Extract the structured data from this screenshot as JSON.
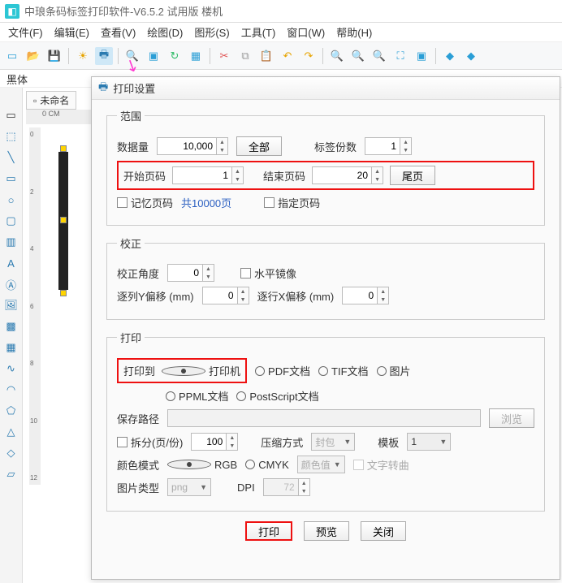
{
  "titlebar": {
    "title": "中琅条码标签打印软件-V6.5.2 试用版 楼机"
  },
  "menubar": {
    "items": [
      "文件(F)",
      "编辑(E)",
      "查看(V)",
      "绘图(D)",
      "图形(S)",
      "工具(T)",
      "窗口(W)",
      "帮助(H)"
    ]
  },
  "fontrow": {
    "label": "黑体"
  },
  "doc": {
    "tab": "未命名",
    "ruler": "0 CM"
  },
  "canvas": {
    "rulemarks": [
      "0",
      "2",
      "4",
      "6",
      "8",
      "10",
      "12"
    ]
  },
  "dialog": {
    "title": "打印设置",
    "range": {
      "legend": "范围",
      "data_count_label": "数据量",
      "data_count": "10,000",
      "all_btn": "全部",
      "label_copies_label": "标签份数",
      "label_copies": "1",
      "start_page_label": "开始页码",
      "start_page": "1",
      "end_page_label": "结束页码",
      "end_page": "20",
      "last_page_btn": "尾页",
      "remember_label": "记忆页码",
      "total_link": "共10000页",
      "specify_label": "指定页码"
    },
    "correct": {
      "legend": "校正",
      "angle_label": "校正角度",
      "angle": "0",
      "h_mirror_label": "水平镜像",
      "row_y_label": "逐列Y偏移 (mm)",
      "row_y": "0",
      "col_x_label": "逐行X偏移 (mm)",
      "col_x": "0"
    },
    "print": {
      "legend": "打印",
      "print_to_label": "打印到",
      "opt_printer": "打印机",
      "opt_pdf": "PDF文档",
      "opt_tif": "TIF文档",
      "opt_img": "图片",
      "opt_ppml": "PPML文档",
      "opt_ps": "PostScript文档",
      "save_path_label": "保存路径",
      "browse_btn": "浏览",
      "split_label": "拆分(页/份)",
      "split_val": "100",
      "compress_label": "压缩方式",
      "compress_val": "封包",
      "template_label": "模板",
      "template_val": "1",
      "color_label": "颜色模式",
      "color_rgb": "RGB",
      "color_cmyk": "CMYK",
      "color_sel": "颜色值",
      "text_curve": "文字转曲",
      "imgtype_label": "图片类型",
      "imgtype_val": "png",
      "dpi_label": "DPI",
      "dpi_val": "72"
    },
    "footer": {
      "print": "打印",
      "preview": "预览",
      "close": "关闭"
    }
  }
}
